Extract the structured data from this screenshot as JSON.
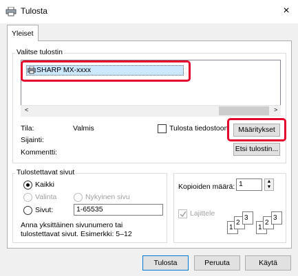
{
  "window": {
    "title": "Tulosta",
    "close_label": "×"
  },
  "tabs": [
    {
      "label": "Yleiset"
    }
  ],
  "select_printer": {
    "group_title": "Valitse tulostin",
    "printers": [
      {
        "name": "SHARP MX-xxxx",
        "selected": true
      }
    ],
    "status_label": "Tila:",
    "status_value": "Valmis",
    "location_label": "Sijainti:",
    "location_value": "",
    "comment_label": "Kommentti:",
    "comment_value": "",
    "print_to_file_label": "Tulosta tiedostoon",
    "print_to_file_checked": false,
    "preferences_label": "Määritykset",
    "find_printer_label": "Etsi tulostin..."
  },
  "page_range": {
    "group_title": "Tulostettavat sivut",
    "options": [
      {
        "label": "Kaikki",
        "checked": true,
        "enabled": true
      },
      {
        "label": "Valinta",
        "checked": false,
        "enabled": false
      },
      {
        "label": "Nykyinen sivu",
        "checked": false,
        "enabled": false
      },
      {
        "label": "Sivut:",
        "checked": false,
        "enabled": true
      }
    ],
    "pages_value": "1-65535",
    "hint_line1": "Anna yksittäinen sivunumero tai",
    "hint_line2": "tulostettavat sivut. Esimerkki: 5–12"
  },
  "copies": {
    "label": "Kopioiden määrä:",
    "value": "1",
    "collate_label": "Lajittele",
    "collate_checked": true,
    "collate_enabled": false
  },
  "footer": {
    "print_label": "Tulosta",
    "cancel_label": "Peruuta",
    "apply_label": "Käytä"
  },
  "colors": {
    "highlight": "#e4002b",
    "selection": "#cce8ff",
    "focus": "#0078d7"
  }
}
